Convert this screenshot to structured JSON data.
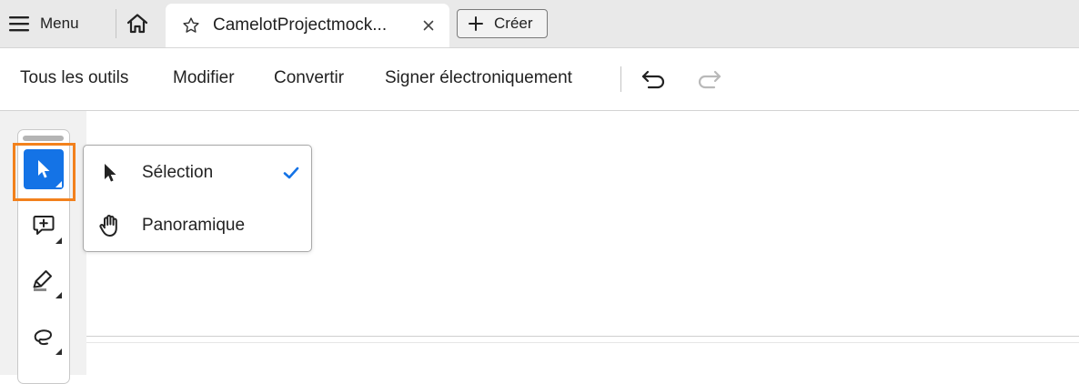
{
  "tabbar": {
    "menu_label": "Menu",
    "document_tab_title": "CamelotProjectmock...",
    "create_label": "Créer"
  },
  "toolbar": {
    "items": [
      "Tous les outils",
      "Modifier",
      "Convertir",
      "Signer électroniquement"
    ]
  },
  "tool_rail": {
    "tools": [
      "select-tool",
      "comment-tool",
      "draw-tool",
      "freehand-tool"
    ],
    "active_tool": "select-tool"
  },
  "flyout": {
    "items": [
      {
        "label": "Sélection",
        "icon": "pointer-icon",
        "checked": true
      },
      {
        "label": "Panoramique",
        "icon": "hand-icon",
        "checked": false
      }
    ]
  },
  "colors": {
    "accent": "#1473e6",
    "focus_ring": "#f2811d",
    "tabbar_bg": "#e9e9e9"
  }
}
